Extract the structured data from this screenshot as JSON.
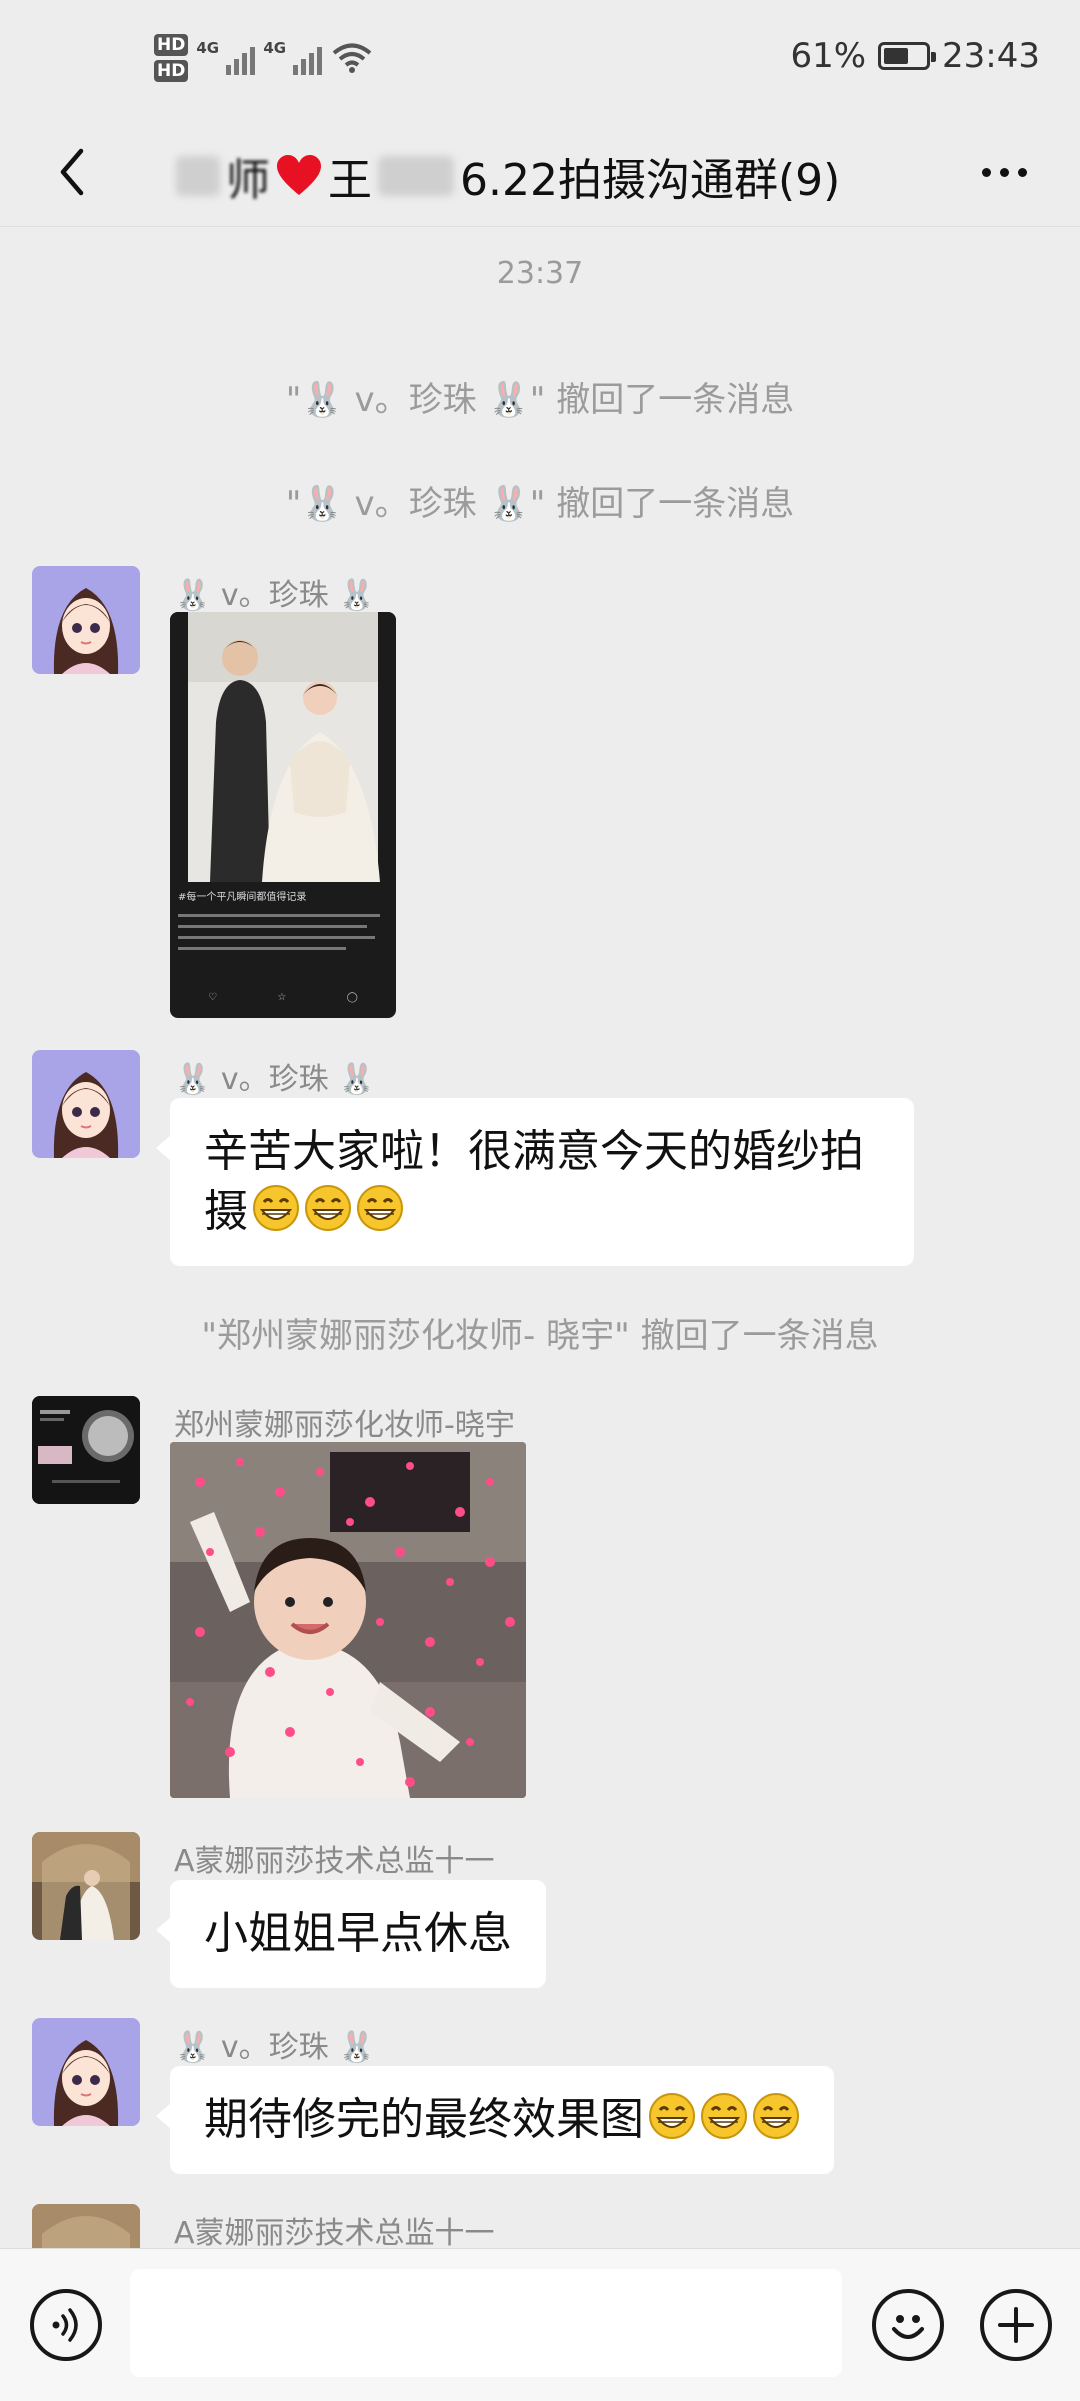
{
  "status_bar": {
    "hd1": "HD",
    "hd2": "HD",
    "net1": "4G",
    "net2": "4G",
    "battery_text": "61%",
    "battery_level": 0.61,
    "time": "23:43",
    "icons": [
      "signal-icon",
      "wifi-icon",
      "battery-icon"
    ]
  },
  "header": {
    "title_visible_suffix": "6.22拍摄沟通群(9)",
    "title_fragment_a": "师",
    "title_fragment_b": "王",
    "back_icon": "chevron-left-icon",
    "more_icon": "more-icon"
  },
  "messages": {
    "time_divider": "23:37",
    "recall_1": "\"🐰 v。珍珠 🐰\" 撤回了一条消息",
    "recall_2": "\"🐰 v。珍珠 🐰\" 撤回了一条消息",
    "sender_1": "🐰 v。珍珠 🐰",
    "shared_card_caption": "#每一个平凡瞬间都值得记录",
    "sender_2": "🐰 v。珍珠 🐰",
    "text_2": "辛苦大家啦！很满意今天的婚纱拍摄",
    "recall_3": "\"郑州蒙娜丽莎化妆师- 晓宇\" 撤回了一条消息",
    "sender_3": "郑州蒙娜丽莎化妆师-晓宇",
    "sender_4": "A蒙娜丽莎技术总监十一",
    "text_4": "小姐姐早点休息",
    "sender_5": "🐰 v。珍珠 🐰",
    "text_5": "期待修完的最终效果图",
    "sender_6": "A蒙娜丽莎技术总监十一"
  },
  "input_bar": {
    "voice_icon": "voice-icon",
    "emoji_icon": "emoji-icon",
    "plus_icon": "plus-icon",
    "text_value": ""
  },
  "colors": {
    "background": "#ededed",
    "bubble": "#ffffff",
    "system_text": "#9b9b9b",
    "sender_text": "#8a8a8a"
  }
}
